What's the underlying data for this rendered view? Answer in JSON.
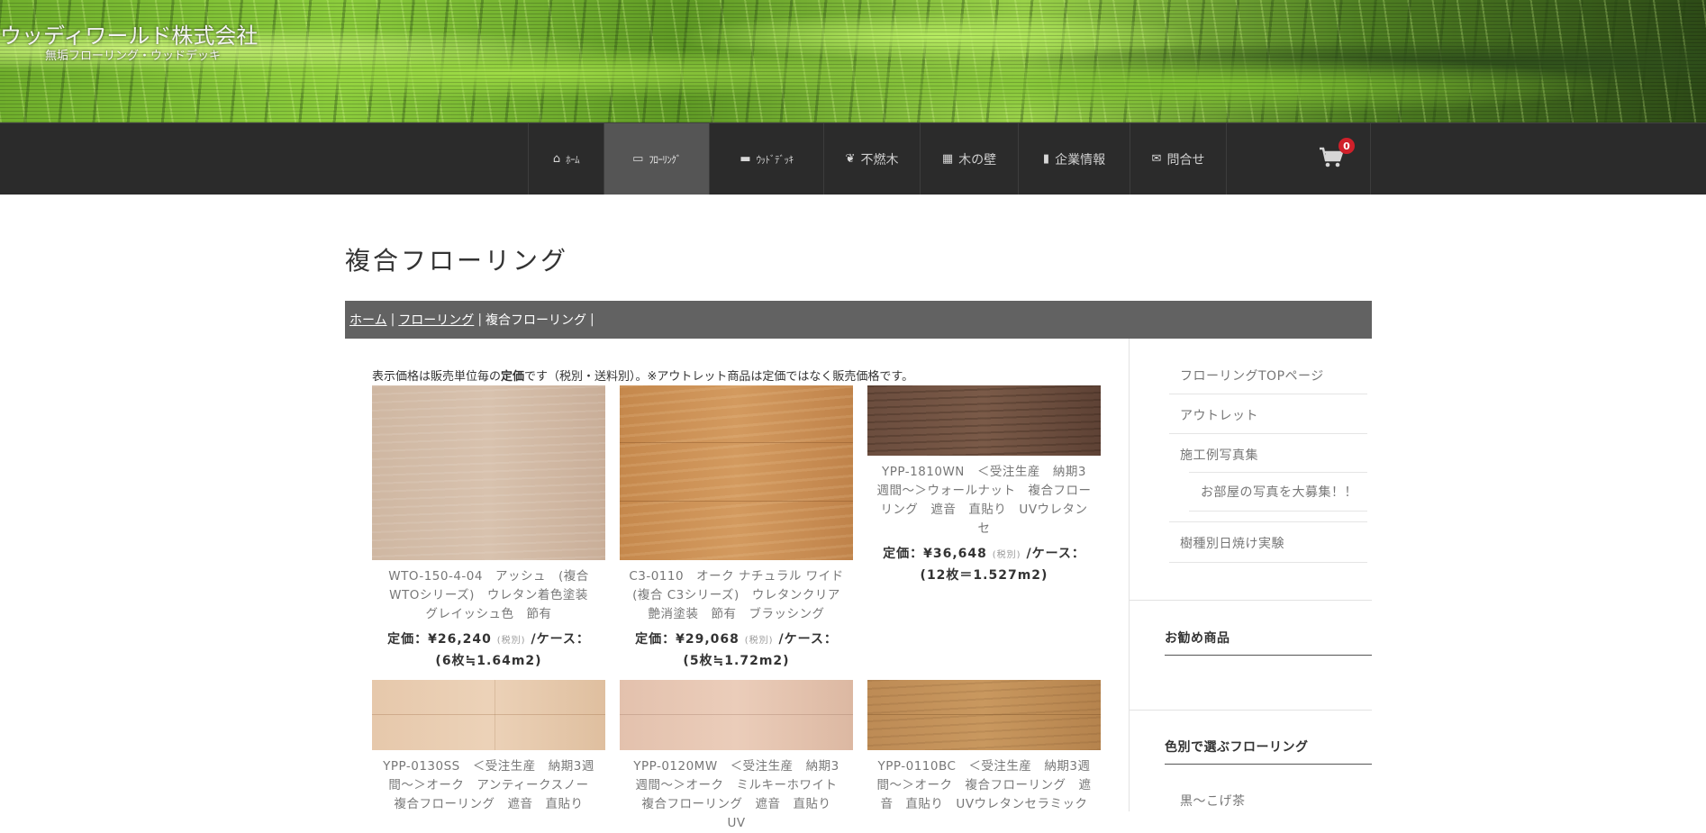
{
  "header": {
    "site_title": "ウッディワールド株式会社",
    "site_subtitle": "無垢フローリング・ウッドデッキ"
  },
  "nav": {
    "items": [
      {
        "label": "ﾎｰﾑ",
        "icon": "home-icon"
      },
      {
        "label": "ﾌﾛｰﾘﾝｸﾞ",
        "icon": "flooring-icon"
      },
      {
        "label": "ｳｯﾄﾞﾃﾞｯｷ",
        "icon": "deck-icon"
      },
      {
        "label": "不燃木",
        "icon": "leaf-icon"
      },
      {
        "label": "木の壁",
        "icon": "wall-icon"
      },
      {
        "label": "企業情報",
        "icon": "building-icon"
      },
      {
        "label": "問合せ",
        "icon": "mail-icon"
      }
    ],
    "active_index": 1,
    "cart_count": "0"
  },
  "page": {
    "title": "複合フローリング",
    "breadcrumb": [
      {
        "label": "ホーム",
        "link": true
      },
      {
        "label": "フローリング",
        "link": true
      },
      {
        "label": "複合フローリング",
        "link": false
      }
    ],
    "notice_prefix": "表示価格は販売単位毎の",
    "notice_bold": "定価",
    "notice_suffix": "です（税別・送料別）。※アウトレット商品は定価ではなく販売価格です。"
  },
  "products": [
    {
      "title": "WTO-150-4-04　アッシュ　(複合WTOシリーズ)　ウレタン着色塗装　グレイッシュ色　節有",
      "price_label": "定価：¥26,240",
      "tax": "(税別)",
      "unit": "/ケース：",
      "unit_detail": "(6枚≒1.64m2)",
      "color": "#cdb5a0"
    },
    {
      "title": "C3-0110　オーク ナチュラル ワイド　(複合 C3シリーズ)　ウレタンクリア艶消塗装　節有　ブラッシング",
      "price_label": "定価：¥29,068",
      "tax": "(税別)",
      "unit": "/ケース：",
      "unit_detail": "(5枚≒1.72m2)",
      "color": "#c88a4f"
    },
    {
      "title": "YPP-1810WN　＜受注生産　納期3週間～＞ウォールナット　複合フローリング　遮音　直貼り　UVウレタンセ",
      "price_label": "定価：¥36,648",
      "tax": "(税別)",
      "unit": "/ケース：",
      "unit_detail": "(12枚＝1.527m2)",
      "color": "#6e4f3f"
    },
    {
      "title": "YPP-0130SS　＜受注生産　納期3週間～＞オーク　アンティークスノー　複合フローリング　遮音　直貼り",
      "color": "#e3c4a8"
    },
    {
      "title": "YPP-0120MW　＜受注生産　納期3週間～＞オーク　ミルキーホワイト　複合フローリング　遮音　直貼り　UV",
      "color": "#e2c0ab"
    },
    {
      "title": "YPP-0110BC　＜受注生産　納期3週間～＞オーク　複合フローリング　遮音　直貼り　UVウレタンセラミック",
      "color": "#c1905a"
    }
  ],
  "sidebar": {
    "links": [
      "フローリングTOPページ",
      "アウトレット",
      "施工例写真集",
      "お部屋の写真を大募集！！",
      "樹種別日焼け実験"
    ],
    "widget_recommend_title": "お勧め商品",
    "widget_color_title": "色別で選ぶフローリング",
    "color_links": [
      "黒～こげ茶"
    ]
  }
}
